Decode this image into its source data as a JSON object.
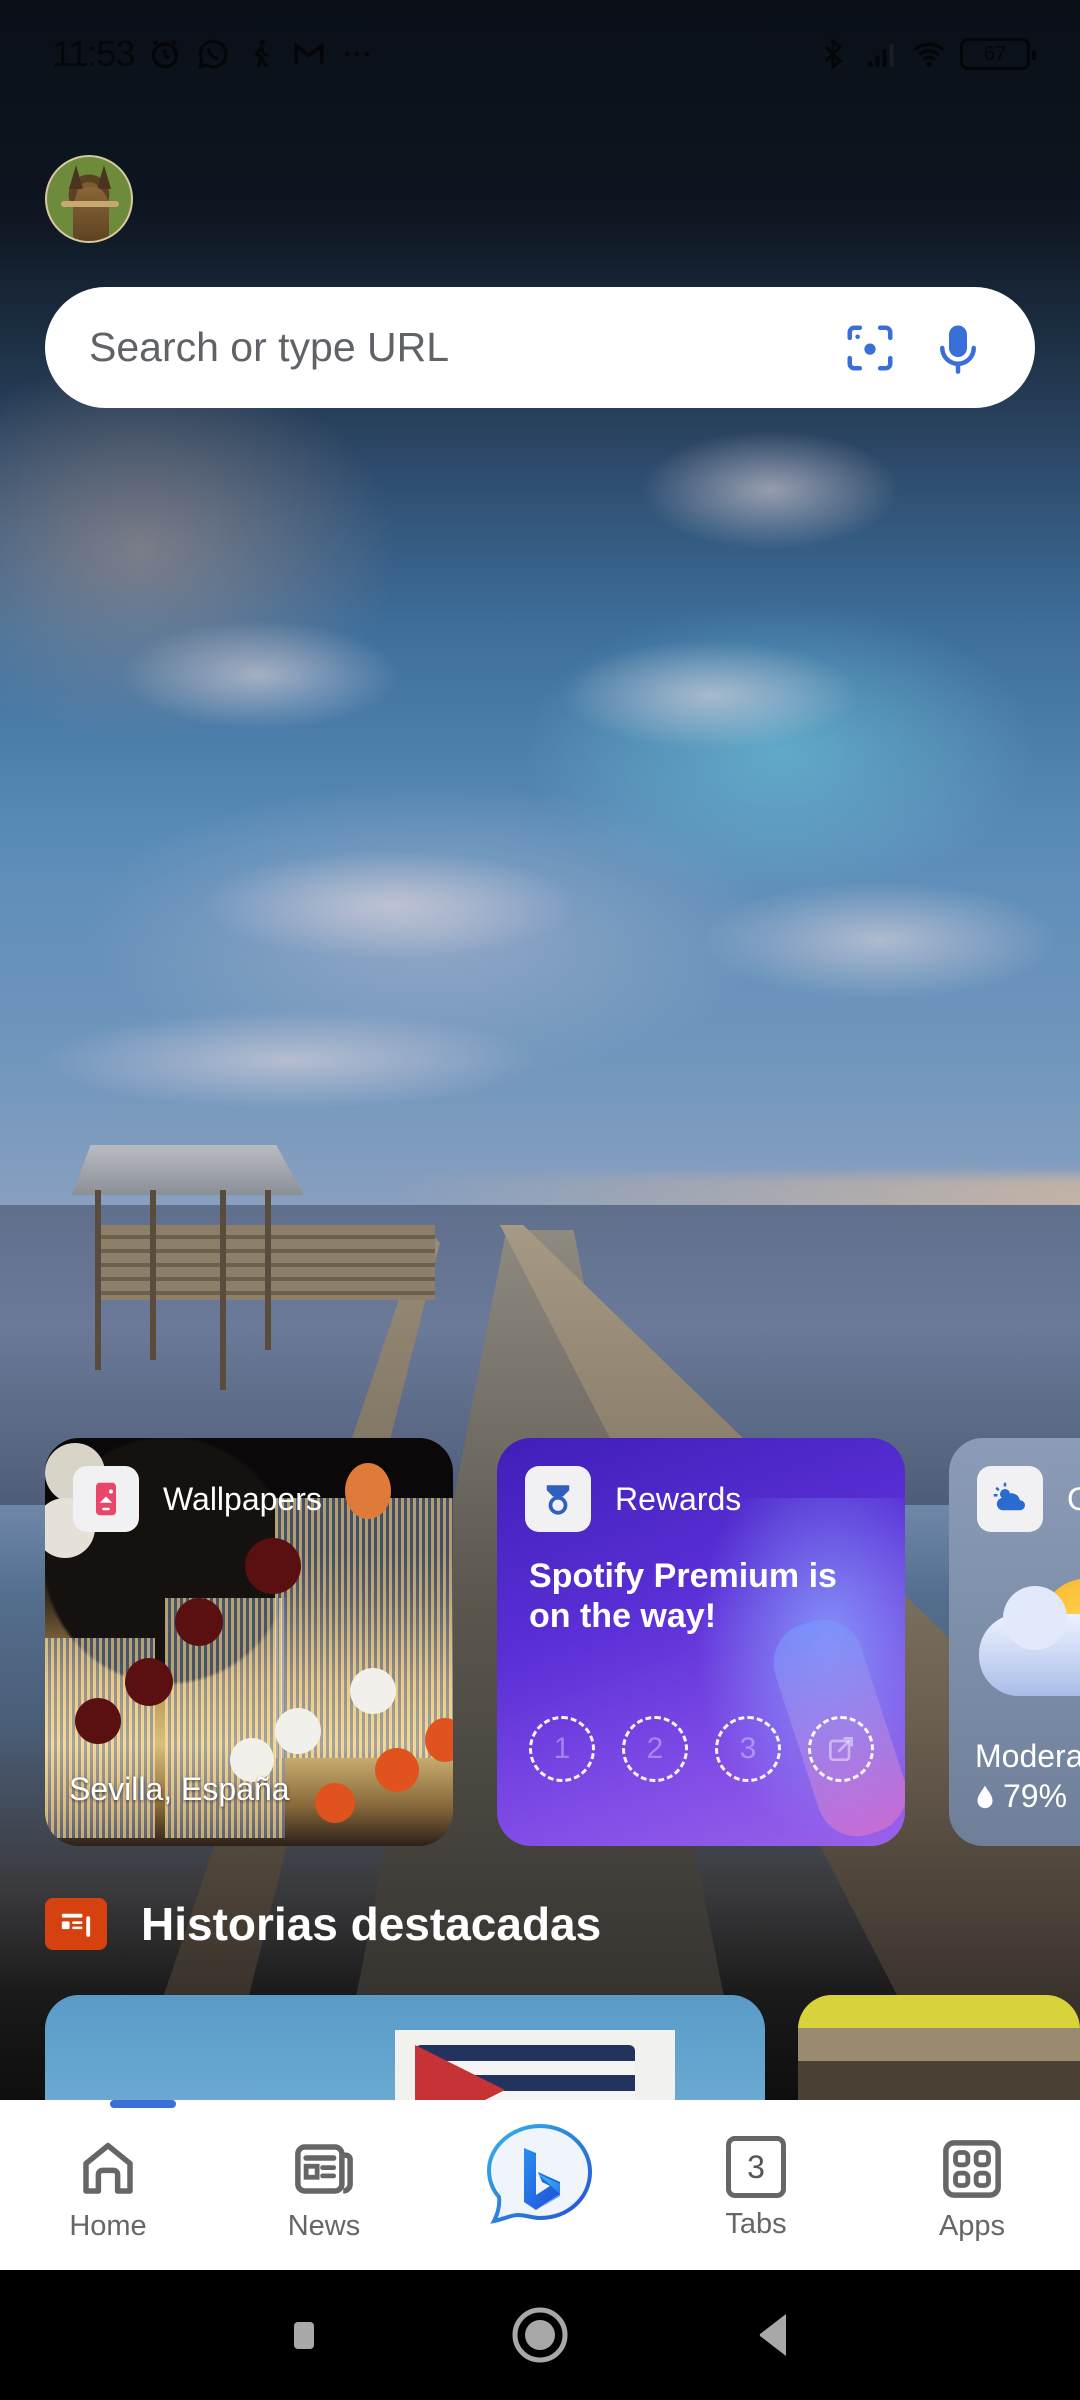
{
  "status_bar": {
    "time": "11:53",
    "left_icons": [
      "alarm-icon",
      "whatsapp-icon",
      "walking-icon",
      "gmail-icon",
      "more-icon"
    ],
    "right_icons": [
      "bluetooth-icon",
      "signal-icon",
      "wifi-icon"
    ],
    "battery_level": "67"
  },
  "profile": {
    "avatar_icon": "avatar-dog-photo"
  },
  "search": {
    "placeholder": "Search or type URL",
    "value": "",
    "visual_search_icon": "camera-scan-icon",
    "voice_icon": "microphone-icon"
  },
  "cards": [
    {
      "id": "wallpapers",
      "label": "Wallpapers",
      "icon": "wallpaper-icon",
      "caption": "Sevilla, España"
    },
    {
      "id": "rewards",
      "label": "Rewards",
      "icon": "medal-icon",
      "title": "Spotify Premium is on the way!",
      "steps": [
        "1",
        "2",
        "3",
        "redeem"
      ]
    },
    {
      "id": "weather",
      "label": "C",
      "icon": "weather-icon",
      "description": "Modera",
      "humidity": "79%"
    }
  ],
  "section": {
    "title": "Historias destacadas",
    "icon": "news-icon"
  },
  "news_cards": [
    {
      "image": "cuban-flag-wall"
    },
    {
      "image": "store-shelf"
    }
  ],
  "bottom_nav": {
    "items": [
      {
        "label": "Home",
        "icon": "home-icon",
        "active": true
      },
      {
        "label": "News",
        "icon": "newspaper-icon",
        "active": false
      },
      {
        "label": "",
        "icon": "copilot-icon",
        "active": false
      },
      {
        "label": "Tabs",
        "icon": "tabs-icon",
        "count": "3",
        "active": false
      },
      {
        "label": "Apps",
        "icon": "apps-grid-icon",
        "active": false
      }
    ],
    "accent_color": "#3a6fd8"
  },
  "system_nav": {
    "buttons": [
      "recents",
      "home",
      "back"
    ]
  }
}
